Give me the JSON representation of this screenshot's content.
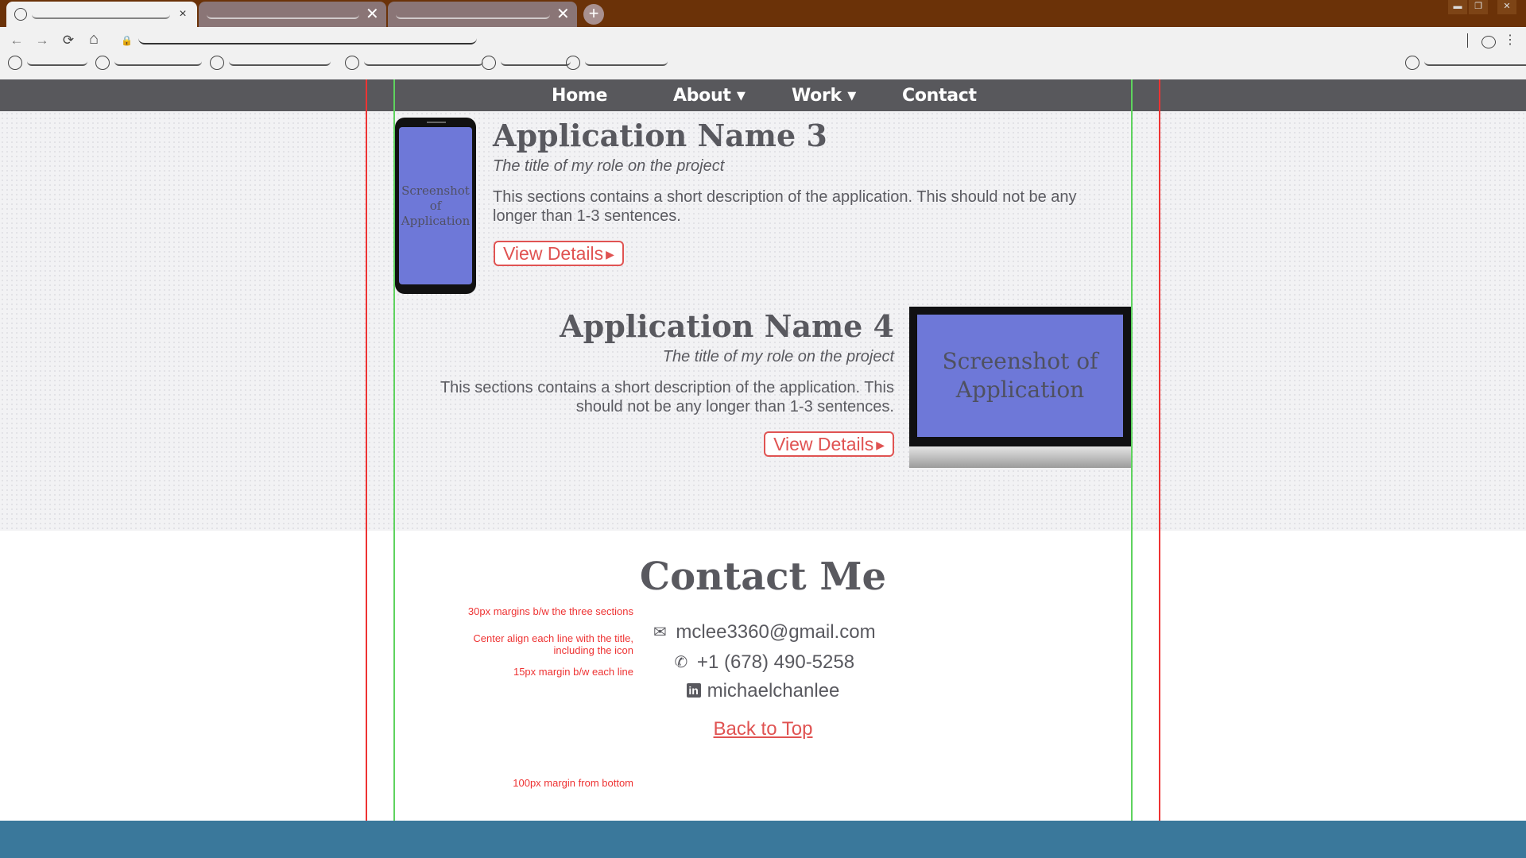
{
  "browser": {
    "tabs": [
      {
        "close": "×"
      },
      {
        "close": "✕"
      },
      {
        "close": "✕"
      }
    ],
    "new_tab": "+",
    "window_controls": [
      "▬",
      "❐",
      "✕"
    ],
    "nav": {
      "back": "←",
      "forward": "→",
      "reload": "⟳",
      "home": "⌂"
    },
    "lock": "🔒",
    "menu": "⋮"
  },
  "site_nav": {
    "home": "Home",
    "about": "About ▾",
    "work": "Work ▾",
    "contact": "Contact"
  },
  "projects": [
    {
      "title": "Application Name 3",
      "role": "The title of my role on the project",
      "description": "This sections contains a short description of the application. This should not be any longer than 1-3 sentences.",
      "button": "View Details",
      "button_arrow": "▶",
      "screenshot_text": "Screenshot of Application"
    },
    {
      "title": "Application Name 4",
      "role": "The title of my role on the project",
      "description": "This sections contains a short description of the application. This should not be any longer than 1-3 sentences.",
      "button": "View Details",
      "button_arrow": "▶",
      "screenshot_text": "Screenshot of Application"
    }
  ],
  "contact": {
    "title": "Contact Me",
    "email": "mclee3360@gmail.com",
    "phone": "+1 (678) 490-5258",
    "linkedin": "michaelchanlee",
    "back_to_top": "Back to Top",
    "icons": {
      "email": "✉",
      "phone": "✆",
      "linkedin": "in"
    }
  },
  "notes": {
    "margins_sections": "30px margins b/w the three sections",
    "center_align": "Center align each line with the title, including the icon",
    "line_margin": "15px margin b/w each line",
    "bottom_margin": "100px margin from bottom"
  },
  "colors": {
    "accent": "#e05352",
    "nav_bg": "#58585c",
    "footer": "#3a789b",
    "screenshot_fill": "#6e78d8",
    "tabbar": "#6b3208"
  }
}
